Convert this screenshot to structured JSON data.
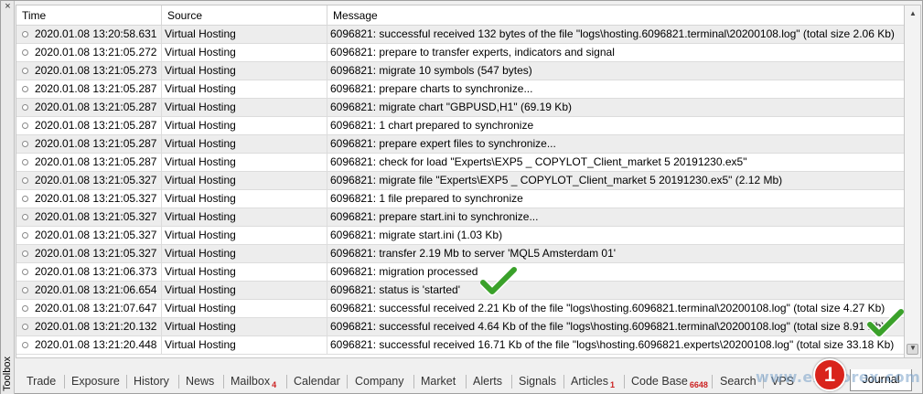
{
  "toolbox": {
    "label": "Toolbox",
    "close_glyph": "×"
  },
  "columns": {
    "time": "Time",
    "source": "Source",
    "message": "Message"
  },
  "rows": [
    {
      "time": "2020.01.08 13:20:58.631",
      "source": "Virtual Hosting",
      "message": "6096821: successful received 132 bytes of the file \"logs\\hosting.6096821.terminal\\20200108.log\" (total size 2.06 Kb)"
    },
    {
      "time": "2020.01.08 13:21:05.272",
      "source": "Virtual Hosting",
      "message": "6096821: prepare to transfer experts, indicators and signal"
    },
    {
      "time": "2020.01.08 13:21:05.273",
      "source": "Virtual Hosting",
      "message": "6096821: migrate 10 symbols (547 bytes)"
    },
    {
      "time": "2020.01.08 13:21:05.287",
      "source": "Virtual Hosting",
      "message": "6096821: prepare charts to synchronize..."
    },
    {
      "time": "2020.01.08 13:21:05.287",
      "source": "Virtual Hosting",
      "message": "6096821: migrate chart \"GBPUSD,H1\" (69.19 Kb)"
    },
    {
      "time": "2020.01.08 13:21:05.287",
      "source": "Virtual Hosting",
      "message": "6096821: 1 chart prepared to synchronize"
    },
    {
      "time": "2020.01.08 13:21:05.287",
      "source": "Virtual Hosting",
      "message": "6096821: prepare expert files to synchronize..."
    },
    {
      "time": "2020.01.08 13:21:05.287",
      "source": "Virtual Hosting",
      "message": "6096821: check for load \"Experts\\EXP5 _ COPYLOT_Client_market 5 20191230.ex5\""
    },
    {
      "time": "2020.01.08 13:21:05.327",
      "source": "Virtual Hosting",
      "message": "6096821: migrate file \"Experts\\EXP5 _ COPYLOT_Client_market 5 20191230.ex5\" (2.12 Mb)"
    },
    {
      "time": "2020.01.08 13:21:05.327",
      "source": "Virtual Hosting",
      "message": "6096821: 1 file prepared to synchronize"
    },
    {
      "time": "2020.01.08 13:21:05.327",
      "source": "Virtual Hosting",
      "message": "6096821: prepare start.ini to synchronize..."
    },
    {
      "time": "2020.01.08 13:21:05.327",
      "source": "Virtual Hosting",
      "message": "6096821: migrate start.ini (1.03 Kb)"
    },
    {
      "time": "2020.01.08 13:21:05.327",
      "source": "Virtual Hosting",
      "message": "6096821: transfer 2.19 Mb to server 'MQL5 Amsterdam 01'"
    },
    {
      "time": "2020.01.08 13:21:06.373",
      "source": "Virtual Hosting",
      "message": "6096821: migration processed"
    },
    {
      "time": "2020.01.08 13:21:06.654",
      "source": "Virtual Hosting",
      "message": "6096821: status is 'started'"
    },
    {
      "time": "2020.01.08 13:21:07.647",
      "source": "Virtual Hosting",
      "message": "6096821: successful received 2.21 Kb of the file \"logs\\hosting.6096821.terminal\\20200108.log\" (total size 4.27 Kb)"
    },
    {
      "time": "2020.01.08 13:21:20.132",
      "source": "Virtual Hosting",
      "message": "6096821: successful received 4.64 Kb of the file \"logs\\hosting.6096821.terminal\\20200108.log\" (total size 8.91 Kb)"
    },
    {
      "time": "2020.01.08 13:21:20.448",
      "source": "Virtual Hosting",
      "message": "6096821: successful received 16.71 Kb of the file \"logs\\hosting.6096821.experts\\20200108.log\" (total size 33.18 Kb)"
    }
  ],
  "tabs": {
    "trade": "Trade",
    "exposure": "Exposure",
    "history": "History",
    "news": "News",
    "mailbox": "Mailbox",
    "mailbox_count": "4",
    "calendar": "Calendar",
    "company": "Company",
    "market": "Market",
    "alerts": "Alerts",
    "signals": "Signals",
    "articles": "Articles",
    "articles_count": "1",
    "codebase": "Code Base",
    "codebase_count": "6648",
    "search": "Search",
    "vps": "VPS",
    "journal": "Journal"
  },
  "watermark": {
    "text": "www.expforex.com"
  },
  "marker": {
    "number": "1"
  },
  "colors": {
    "check": "#3aa12a",
    "marker": "#d9241c",
    "badge": "#cc2222"
  }
}
